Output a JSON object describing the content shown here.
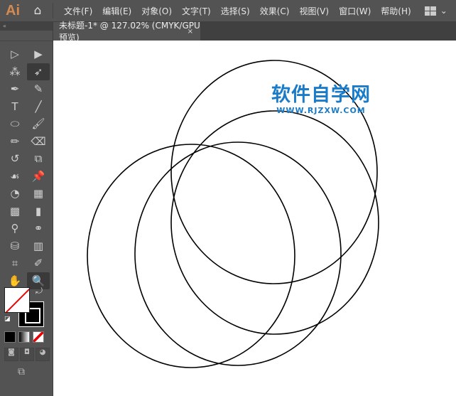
{
  "app": {
    "logo": "Ai",
    "home_icon": "home-icon"
  },
  "menu": [
    "文件(F)",
    "编辑(E)",
    "对象(O)",
    "文字(T)",
    "选择(S)",
    "效果(C)",
    "视图(V)",
    "窗口(W)",
    "帮助(H)"
  ],
  "document_tab": {
    "title": "未标题-1* @ 127.02% (CMYK/GPU 预览)",
    "close": "×"
  },
  "toolbar": {
    "collapse": "«",
    "tools": [
      {
        "name": "selection-tool",
        "glyph": "▷"
      },
      {
        "name": "direct-selection-tool",
        "glyph": "▶"
      },
      {
        "name": "magic-wand-tool",
        "glyph": "⁂"
      },
      {
        "name": "lasso-tool",
        "glyph": "➶",
        "active": true
      },
      {
        "name": "pen-tool",
        "glyph": "✒"
      },
      {
        "name": "curvature-tool",
        "glyph": "✎"
      },
      {
        "name": "type-tool",
        "glyph": "T"
      },
      {
        "name": "line-tool",
        "glyph": "╱"
      },
      {
        "name": "ellipse-tool",
        "glyph": "⬭"
      },
      {
        "name": "paintbrush-tool",
        "glyph": "🖌"
      },
      {
        "name": "pencil-tool",
        "glyph": "✏"
      },
      {
        "name": "eraser-tool",
        "glyph": "⌫"
      },
      {
        "name": "rotate-tool",
        "glyph": "↺"
      },
      {
        "name": "scale-tool",
        "glyph": "⧉"
      },
      {
        "name": "warp-tool",
        "glyph": "☙"
      },
      {
        "name": "puppet-warp-tool",
        "glyph": "📌"
      },
      {
        "name": "shape-builder-tool",
        "glyph": "◔"
      },
      {
        "name": "perspective-grid-tool",
        "glyph": "▦"
      },
      {
        "name": "mesh-tool",
        "glyph": "▩"
      },
      {
        "name": "gradient-tool",
        "glyph": "▮"
      },
      {
        "name": "eyedropper-tool",
        "glyph": "⚲"
      },
      {
        "name": "blend-tool",
        "glyph": "⚭"
      },
      {
        "name": "symbol-sprayer-tool",
        "glyph": "⛁"
      },
      {
        "name": "column-graph-tool",
        "glyph": "▥"
      },
      {
        "name": "artboard-tool",
        "glyph": "⌗"
      },
      {
        "name": "slice-tool",
        "glyph": "✐"
      },
      {
        "name": "hand-tool",
        "glyph": "✋"
      },
      {
        "name": "zoom-tool",
        "glyph": "🔍",
        "active": true
      }
    ]
  },
  "watermark": {
    "title": "软件自学网",
    "url": "WWW.RJZXW.COM",
    "color": "#1a7cc9"
  },
  "colors": {
    "accent": "#d58a50",
    "stroke": "#000000"
  }
}
